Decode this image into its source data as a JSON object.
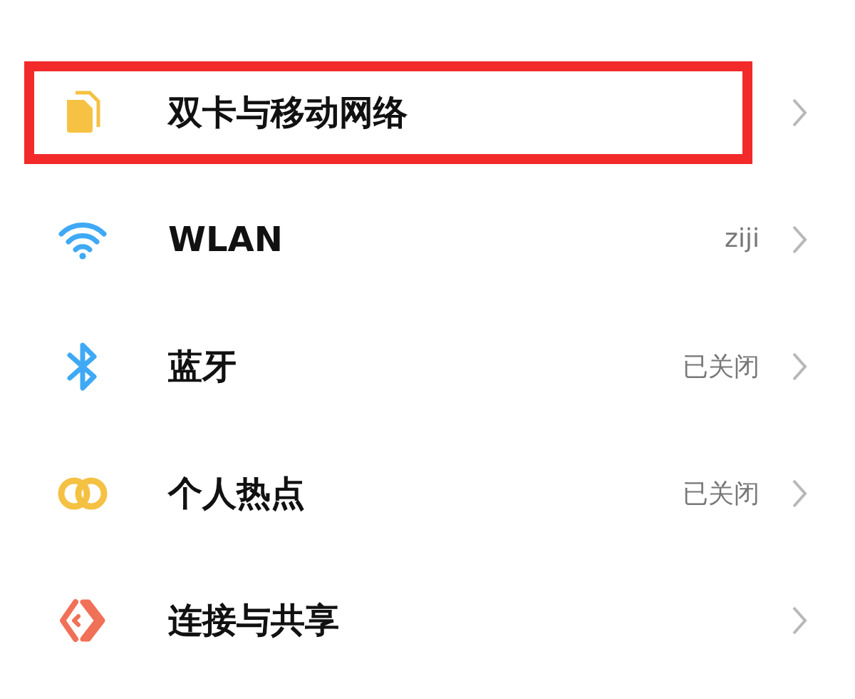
{
  "settings_items": [
    {
      "kind": "sim",
      "label": "双卡与移动网络",
      "highlighted": true
    },
    {
      "kind": "wifi",
      "label": "WLAN",
      "value": "ziji",
      "highlighted": false
    },
    {
      "kind": "bluetooth",
      "label": "蓝牙",
      "value": "已关闭",
      "highlighted": false
    },
    {
      "kind": "hotspot",
      "label": "个人热点",
      "value": "已关闭",
      "highlighted": false
    },
    {
      "kind": "share",
      "label": "连接与共享",
      "highlighted": false
    }
  ]
}
